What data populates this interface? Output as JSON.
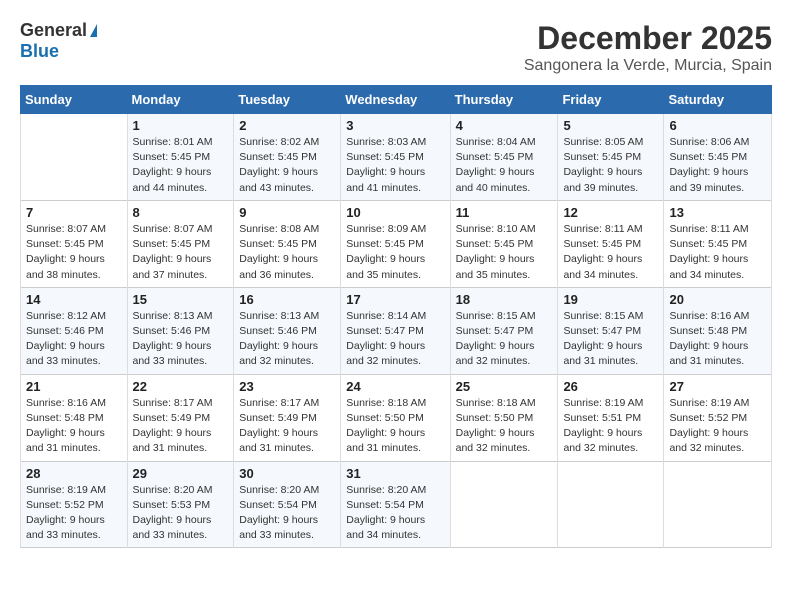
{
  "header": {
    "logo_general": "General",
    "logo_blue": "Blue",
    "month": "December 2025",
    "location": "Sangonera la Verde, Murcia, Spain"
  },
  "weekdays": [
    "Sunday",
    "Monday",
    "Tuesday",
    "Wednesday",
    "Thursday",
    "Friday",
    "Saturday"
  ],
  "weeks": [
    [
      {
        "day": "",
        "info": ""
      },
      {
        "day": "1",
        "info": "Sunrise: 8:01 AM\nSunset: 5:45 PM\nDaylight: 9 hours\nand 44 minutes."
      },
      {
        "day": "2",
        "info": "Sunrise: 8:02 AM\nSunset: 5:45 PM\nDaylight: 9 hours\nand 43 minutes."
      },
      {
        "day": "3",
        "info": "Sunrise: 8:03 AM\nSunset: 5:45 PM\nDaylight: 9 hours\nand 41 minutes."
      },
      {
        "day": "4",
        "info": "Sunrise: 8:04 AM\nSunset: 5:45 PM\nDaylight: 9 hours\nand 40 minutes."
      },
      {
        "day": "5",
        "info": "Sunrise: 8:05 AM\nSunset: 5:45 PM\nDaylight: 9 hours\nand 39 minutes."
      },
      {
        "day": "6",
        "info": "Sunrise: 8:06 AM\nSunset: 5:45 PM\nDaylight: 9 hours\nand 39 minutes."
      }
    ],
    [
      {
        "day": "7",
        "info": "Sunrise: 8:07 AM\nSunset: 5:45 PM\nDaylight: 9 hours\nand 38 minutes."
      },
      {
        "day": "8",
        "info": "Sunrise: 8:07 AM\nSunset: 5:45 PM\nDaylight: 9 hours\nand 37 minutes."
      },
      {
        "day": "9",
        "info": "Sunrise: 8:08 AM\nSunset: 5:45 PM\nDaylight: 9 hours\nand 36 minutes."
      },
      {
        "day": "10",
        "info": "Sunrise: 8:09 AM\nSunset: 5:45 PM\nDaylight: 9 hours\nand 35 minutes."
      },
      {
        "day": "11",
        "info": "Sunrise: 8:10 AM\nSunset: 5:45 PM\nDaylight: 9 hours\nand 35 minutes."
      },
      {
        "day": "12",
        "info": "Sunrise: 8:11 AM\nSunset: 5:45 PM\nDaylight: 9 hours\nand 34 minutes."
      },
      {
        "day": "13",
        "info": "Sunrise: 8:11 AM\nSunset: 5:45 PM\nDaylight: 9 hours\nand 34 minutes."
      }
    ],
    [
      {
        "day": "14",
        "info": "Sunrise: 8:12 AM\nSunset: 5:46 PM\nDaylight: 9 hours\nand 33 minutes."
      },
      {
        "day": "15",
        "info": "Sunrise: 8:13 AM\nSunset: 5:46 PM\nDaylight: 9 hours\nand 33 minutes."
      },
      {
        "day": "16",
        "info": "Sunrise: 8:13 AM\nSunset: 5:46 PM\nDaylight: 9 hours\nand 32 minutes."
      },
      {
        "day": "17",
        "info": "Sunrise: 8:14 AM\nSunset: 5:47 PM\nDaylight: 9 hours\nand 32 minutes."
      },
      {
        "day": "18",
        "info": "Sunrise: 8:15 AM\nSunset: 5:47 PM\nDaylight: 9 hours\nand 32 minutes."
      },
      {
        "day": "19",
        "info": "Sunrise: 8:15 AM\nSunset: 5:47 PM\nDaylight: 9 hours\nand 31 minutes."
      },
      {
        "day": "20",
        "info": "Sunrise: 8:16 AM\nSunset: 5:48 PM\nDaylight: 9 hours\nand 31 minutes."
      }
    ],
    [
      {
        "day": "21",
        "info": "Sunrise: 8:16 AM\nSunset: 5:48 PM\nDaylight: 9 hours\nand 31 minutes."
      },
      {
        "day": "22",
        "info": "Sunrise: 8:17 AM\nSunset: 5:49 PM\nDaylight: 9 hours\nand 31 minutes."
      },
      {
        "day": "23",
        "info": "Sunrise: 8:17 AM\nSunset: 5:49 PM\nDaylight: 9 hours\nand 31 minutes."
      },
      {
        "day": "24",
        "info": "Sunrise: 8:18 AM\nSunset: 5:50 PM\nDaylight: 9 hours\nand 31 minutes."
      },
      {
        "day": "25",
        "info": "Sunrise: 8:18 AM\nSunset: 5:50 PM\nDaylight: 9 hours\nand 32 minutes."
      },
      {
        "day": "26",
        "info": "Sunrise: 8:19 AM\nSunset: 5:51 PM\nDaylight: 9 hours\nand 32 minutes."
      },
      {
        "day": "27",
        "info": "Sunrise: 8:19 AM\nSunset: 5:52 PM\nDaylight: 9 hours\nand 32 minutes."
      }
    ],
    [
      {
        "day": "28",
        "info": "Sunrise: 8:19 AM\nSunset: 5:52 PM\nDaylight: 9 hours\nand 33 minutes."
      },
      {
        "day": "29",
        "info": "Sunrise: 8:20 AM\nSunset: 5:53 PM\nDaylight: 9 hours\nand 33 minutes."
      },
      {
        "day": "30",
        "info": "Sunrise: 8:20 AM\nSunset: 5:54 PM\nDaylight: 9 hours\nand 33 minutes."
      },
      {
        "day": "31",
        "info": "Sunrise: 8:20 AM\nSunset: 5:54 PM\nDaylight: 9 hours\nand 34 minutes."
      },
      {
        "day": "",
        "info": ""
      },
      {
        "day": "",
        "info": ""
      },
      {
        "day": "",
        "info": ""
      }
    ]
  ]
}
